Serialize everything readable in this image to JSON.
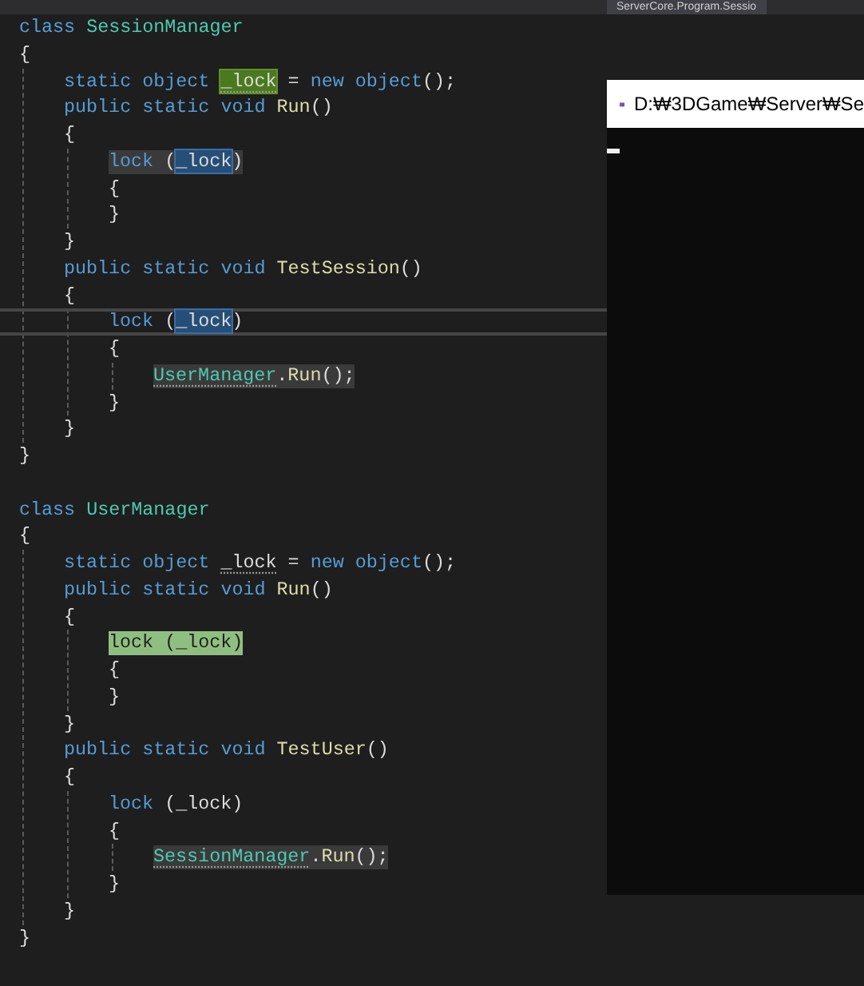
{
  "document_tab": {
    "label": "ServerCore.Program.Sessio"
  },
  "code": [
    {
      "kind": "code",
      "tokens": [
        {
          "text": "class",
          "kind": "keyword"
        },
        {
          "text": " SessionManager",
          "kind": "type"
        }
      ]
    },
    {
      "kind": "code",
      "tokens": [
        {
          "text": "{",
          "kind": "plain"
        }
      ],
      "children": [
        {
          "kind": "code",
          "tokens": [
            {
              "text": "static object ",
              "kind": "keyword"
            },
            {
              "text": "_lock",
              "kind": "definition",
              "suggestion": true
            },
            {
              "text": " = ",
              "kind": "plain"
            },
            {
              "text": "new object",
              "kind": "keyword"
            },
            {
              "text": "();",
              "kind": "plain"
            }
          ]
        },
        {
          "kind": "code",
          "tokens": [
            {
              "text": "public static void",
              "kind": "keyword"
            },
            {
              "text": " Run",
              "kind": "method"
            },
            {
              "text": "()",
              "kind": "plain"
            }
          ]
        },
        {
          "kind": "code",
          "tokens": [
            {
              "text": "{",
              "kind": "plain"
            }
          ],
          "children": [
            {
              "kind": "statement",
              "tokens": [
                {
                  "text": "lock",
                  "kind": "keyword"
                },
                {
                  "text": " (",
                  "kind": "plain"
                },
                {
                  "text": "_lock",
                  "kind": "reference"
                },
                {
                  "text": ")",
                  "kind": "plain"
                }
              ]
            },
            {
              "kind": "code",
              "tokens": [
                {
                  "text": "{",
                  "kind": "plain"
                }
              ]
            },
            {
              "kind": "code",
              "tokens": [
                {
                  "text": "}",
                  "kind": "plain"
                }
              ]
            }
          ]
        },
        {
          "kind": "code",
          "tokens": [
            {
              "text": "}",
              "kind": "plain"
            }
          ]
        },
        {
          "kind": "code",
          "tokens": [
            {
              "text": "public static void",
              "kind": "keyword"
            },
            {
              "text": " TestSession",
              "kind": "method"
            },
            {
              "text": "()",
              "kind": "plain"
            }
          ]
        },
        {
          "kind": "code",
          "tokens": [
            {
              "text": "{",
              "kind": "plain"
            }
          ],
          "children": [
            {
              "kind": "code",
              "current": true,
              "tokens": [
                {
                  "text": "lock",
                  "kind": "keyword"
                },
                {
                  "text": " (",
                  "kind": "plain"
                },
                {
                  "text": "_lock",
                  "kind": "reference"
                },
                {
                  "text": ")",
                  "kind": "plain"
                }
              ]
            },
            {
              "kind": "code",
              "tokens": [
                {
                  "text": "{",
                  "kind": "plain"
                }
              ],
              "children": [
                {
                  "kind": "statement",
                  "tokens": [
                    {
                      "text": "UserManager",
                      "kind": "type",
                      "suggestion": true
                    },
                    {
                      "text": ".",
                      "kind": "plain"
                    },
                    {
                      "text": "Run",
                      "kind": "method"
                    },
                    {
                      "text": "();",
                      "kind": "plain"
                    }
                  ]
                }
              ]
            },
            {
              "kind": "code",
              "tokens": [
                {
                  "text": "}",
                  "kind": "plain"
                }
              ]
            }
          ]
        },
        {
          "kind": "code",
          "tokens": [
            {
              "text": "}",
              "kind": "plain"
            }
          ]
        }
      ]
    },
    {
      "kind": "code",
      "tokens": [
        {
          "text": "}",
          "kind": "plain"
        }
      ]
    },
    {
      "kind": "code",
      "blank_before": true,
      "tokens": [
        {
          "text": "class",
          "kind": "keyword"
        },
        {
          "text": " UserManager",
          "kind": "type"
        }
      ]
    },
    {
      "kind": "code",
      "tokens": [
        {
          "text": "{",
          "kind": "plain"
        }
      ],
      "children": [
        {
          "kind": "code",
          "tokens": [
            {
              "text": "static object ",
              "kind": "keyword"
            },
            {
              "text": "_lock",
              "kind": "plain",
              "suggestion": true
            },
            {
              "text": " = ",
              "kind": "plain"
            },
            {
              "text": "new object",
              "kind": "keyword"
            },
            {
              "text": "();",
              "kind": "plain"
            }
          ]
        },
        {
          "kind": "code",
          "tokens": [
            {
              "text": "public static void",
              "kind": "keyword"
            },
            {
              "text": " Run",
              "kind": "method"
            },
            {
              "text": "()",
              "kind": "plain"
            }
          ]
        },
        {
          "kind": "code",
          "tokens": [
            {
              "text": "{",
              "kind": "plain"
            }
          ],
          "children": [
            {
              "kind": "active",
              "tokens": [
                {
                  "text": "lock",
                  "kind": "keyword"
                },
                {
                  "text": " (_lock)",
                  "kind": "plain"
                }
              ]
            },
            {
              "kind": "code",
              "tokens": [
                {
                  "text": "{",
                  "kind": "plain"
                }
              ]
            },
            {
              "kind": "code",
              "tokens": [
                {
                  "text": "}",
                  "kind": "plain"
                }
              ]
            }
          ]
        },
        {
          "kind": "code",
          "tokens": [
            {
              "text": "}",
              "kind": "plain"
            }
          ]
        },
        {
          "kind": "code",
          "tokens": [
            {
              "text": "public static void",
              "kind": "keyword"
            },
            {
              "text": " TestUser",
              "kind": "method"
            },
            {
              "text": "()",
              "kind": "plain"
            }
          ]
        },
        {
          "kind": "code",
          "tokens": [
            {
              "text": "{",
              "kind": "plain"
            }
          ],
          "children": [
            {
              "kind": "code",
              "tokens": [
                {
                  "text": "lock",
                  "kind": "keyword"
                },
                {
                  "text": " (_lock)",
                  "kind": "plain"
                }
              ]
            },
            {
              "kind": "code",
              "tokens": [
                {
                  "text": "{",
                  "kind": "plain"
                }
              ],
              "children": [
                {
                  "kind": "statement",
                  "tokens": [
                    {
                      "text": "SessionManager",
                      "kind": "type",
                      "suggestion": true
                    },
                    {
                      "text": ".",
                      "kind": "plain"
                    },
                    {
                      "text": "Run",
                      "kind": "method"
                    },
                    {
                      "text": "();",
                      "kind": "plain"
                    }
                  ]
                }
              ]
            },
            {
              "kind": "code",
              "tokens": [
                {
                  "text": "}",
                  "kind": "plain"
                }
              ]
            }
          ]
        },
        {
          "kind": "code",
          "tokens": [
            {
              "text": "}",
              "kind": "plain"
            }
          ]
        }
      ]
    },
    {
      "kind": "code",
      "tokens": [
        {
          "text": "}",
          "kind": "plain"
        }
      ]
    }
  ],
  "console_window": {
    "title": "D:₩3DGame₩Server₩Se"
  }
}
